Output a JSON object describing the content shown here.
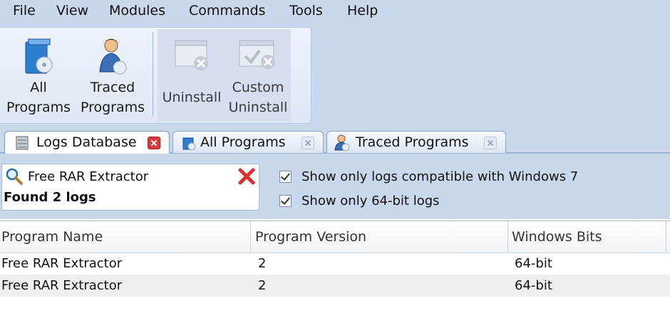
{
  "menu": [
    "File",
    "View",
    "Modules",
    "Commands",
    "Tools",
    "Help"
  ],
  "ribbon": {
    "all_programs": [
      "All",
      "Programs"
    ],
    "traced_programs": [
      "Traced",
      "Programs"
    ],
    "uninstall": "Uninstall",
    "custom_uninstall": [
      "Custom",
      "Uninstall"
    ]
  },
  "tabs": [
    {
      "label": "Logs Database",
      "active": true
    },
    {
      "label": "All Programs",
      "active": false
    },
    {
      "label": "Traced Programs",
      "active": false
    }
  ],
  "search": {
    "value": "Free RAR Extractor",
    "status": "Found 2 logs"
  },
  "filters": [
    {
      "label": "Show only logs compatible with Windows 7",
      "checked": true
    },
    {
      "label": "Show only 64-bit logs",
      "checked": true
    }
  ],
  "table": {
    "columns": [
      "Program Name",
      "Program Version",
      "Windows Bits"
    ],
    "rows": [
      [
        "Free RAR Extractor",
        "2",
        "64-bit"
      ],
      [
        "Free RAR Extractor",
        "2",
        "64-bit"
      ]
    ]
  },
  "colors": {
    "accent": "#c9d8ec",
    "close_active": "#d93a3a"
  }
}
